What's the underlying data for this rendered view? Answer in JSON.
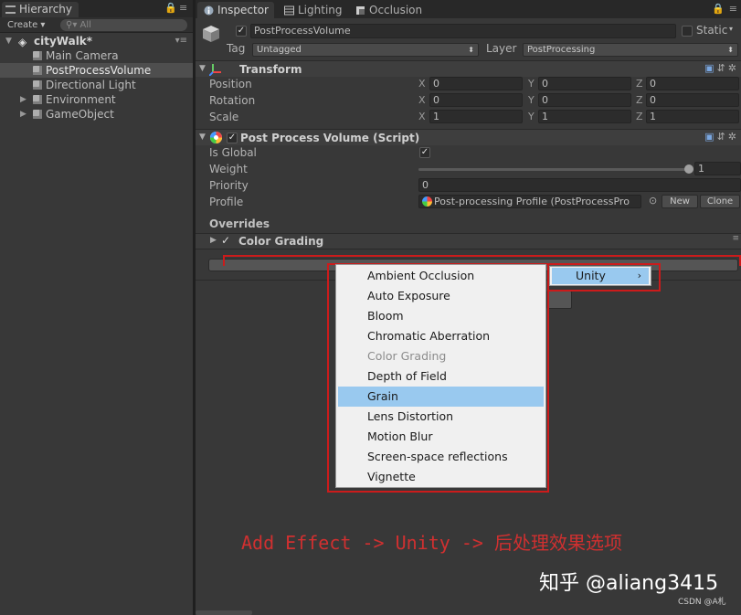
{
  "hierarchy": {
    "tab_label": "Hierarchy",
    "create_label": "Create",
    "search_placeholder": "All",
    "scene": "cityWalk*",
    "items": [
      {
        "label": "Main Camera",
        "expandable": false,
        "selected": false
      },
      {
        "label": "PostProcessVolume",
        "expandable": false,
        "selected": true
      },
      {
        "label": "Directional Light",
        "expandable": false,
        "selected": false
      },
      {
        "label": "Environment",
        "expandable": true,
        "selected": false
      },
      {
        "label": "GameObject",
        "expandable": true,
        "selected": false
      }
    ]
  },
  "inspector": {
    "tabs": [
      {
        "label": "Inspector",
        "icon": "info-icon",
        "active": true
      },
      {
        "label": "Lighting",
        "icon": "lighting-icon",
        "active": false
      },
      {
        "label": "Occlusion",
        "icon": "occlusion-icon",
        "active": false
      }
    ],
    "object": {
      "name": "PostProcessVolume",
      "static_label": "Static",
      "tag_label": "Tag",
      "tag_value": "Untagged",
      "layer_label": "Layer",
      "layer_value": "PostProcessing"
    },
    "transform": {
      "title": "Transform",
      "position": {
        "label": "Position",
        "x": "0",
        "y": "0",
        "z": "0"
      },
      "rotation": {
        "label": "Rotation",
        "x": "0",
        "y": "0",
        "z": "0"
      },
      "scale": {
        "label": "Scale",
        "x": "1",
        "y": "1",
        "z": "1"
      }
    },
    "ppv": {
      "title": "Post Process Volume (Script)",
      "is_global_label": "Is Global",
      "weight_label": "Weight",
      "weight_value": "1",
      "weight_level": 1.0,
      "priority_label": "Priority",
      "priority_value": "0",
      "profile_label": "Profile",
      "profile_value": "Post-processing Profile (PostProcessPro",
      "new_label": "New",
      "clone_label": "Clone",
      "overrides_label": "Overrides",
      "color_grading_label": "Color Grading"
    }
  },
  "menu": {
    "items": [
      {
        "label": "Ambient Occlusion",
        "state": "normal"
      },
      {
        "label": "Auto Exposure",
        "state": "normal"
      },
      {
        "label": "Bloom",
        "state": "normal"
      },
      {
        "label": "Chromatic Aberration",
        "state": "normal"
      },
      {
        "label": "Color Grading",
        "state": "disabled"
      },
      {
        "label": "Depth of Field",
        "state": "normal"
      },
      {
        "label": "Grain",
        "state": "highlighted"
      },
      {
        "label": "Lens Distortion",
        "state": "normal"
      },
      {
        "label": "Motion Blur",
        "state": "normal"
      },
      {
        "label": "Screen-space reflections",
        "state": "normal"
      },
      {
        "label": "Vignette",
        "state": "normal"
      }
    ],
    "submenu_label": "Unity"
  },
  "annotation": "Add Effect -> Unity -> 后处理效果选项",
  "watermark": "知乎 @aliang3415",
  "watermark_small": "CSDN @A札",
  "colors": {
    "highlight": "#99c9ef",
    "annotation_red": "#cc1b1b",
    "panel_bg": "#383838"
  }
}
